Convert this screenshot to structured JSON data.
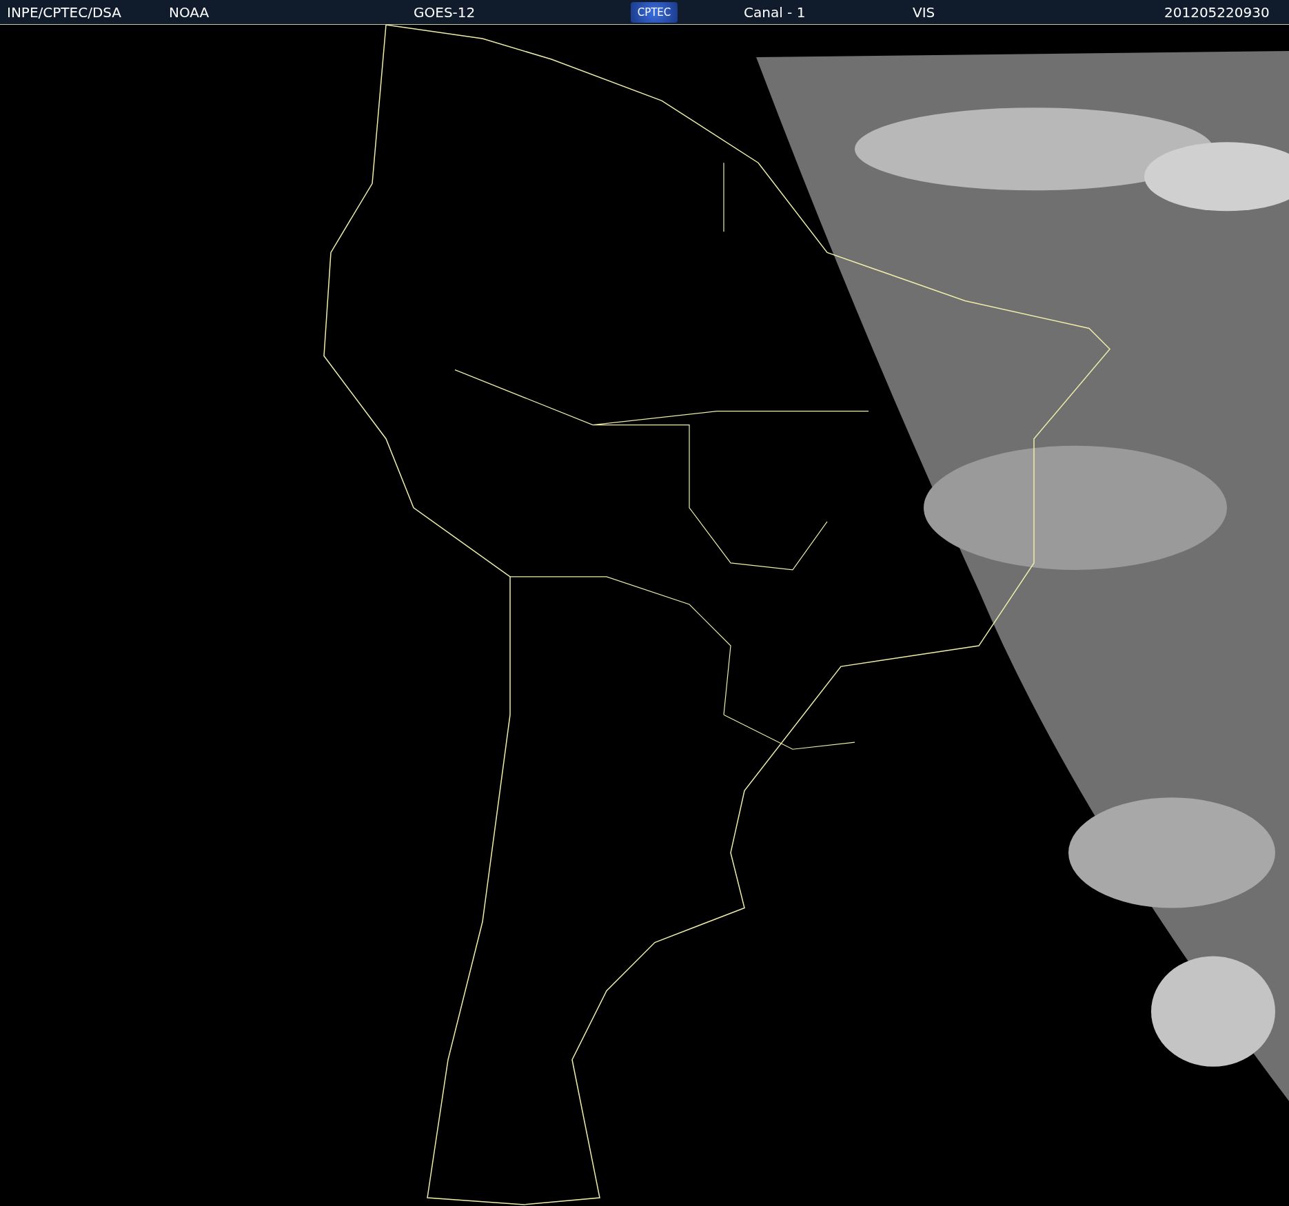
{
  "header": {
    "source": "INPE/CPTEC/DSA",
    "agency": "NOAA",
    "satellite": "GOES-12",
    "logo": "CPTEC",
    "channel": "Canal - 1",
    "band": "VIS",
    "timestamp": "201205220930"
  }
}
